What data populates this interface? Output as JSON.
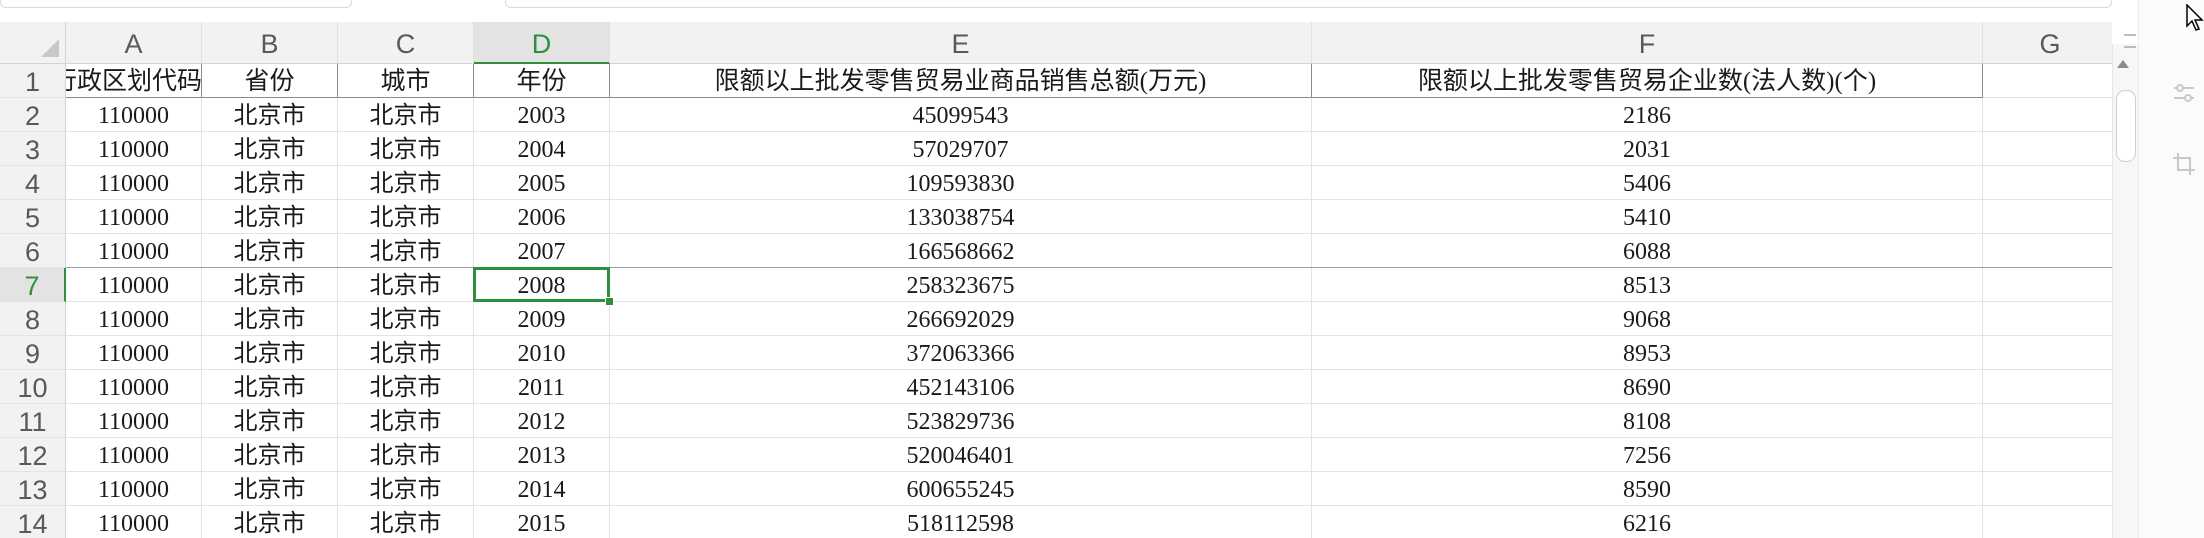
{
  "spreadsheet": {
    "columns": [
      "A",
      "B",
      "C",
      "D",
      "E",
      "F",
      "G"
    ],
    "active_column": "D",
    "active_row": "7",
    "header_row": {
      "number": "1",
      "cells": [
        "行政区划代码",
        "省份",
        "城市",
        "年份",
        "限额以上批发零售贸易业商品销售总额(万元)",
        "限额以上批发零售贸易企业数(法人数)(个)"
      ]
    },
    "rows": [
      {
        "number": "2",
        "cells": [
          "110000",
          "北京市",
          "北京市",
          "2003",
          "45099543",
          "2186"
        ]
      },
      {
        "number": "3",
        "cells": [
          "110000",
          "北京市",
          "北京市",
          "2004",
          "57029707",
          "2031"
        ]
      },
      {
        "number": "4",
        "cells": [
          "110000",
          "北京市",
          "北京市",
          "2005",
          "109593830",
          "5406"
        ]
      },
      {
        "number": "5",
        "cells": [
          "110000",
          "北京市",
          "北京市",
          "2006",
          "133038754",
          "5410"
        ]
      },
      {
        "number": "6",
        "cells": [
          "110000",
          "北京市",
          "北京市",
          "2007",
          "166568662",
          "6088"
        ]
      },
      {
        "number": "7",
        "cells": [
          "110000",
          "北京市",
          "北京市",
          "2008",
          "258323675",
          "8513"
        ]
      },
      {
        "number": "8",
        "cells": [
          "110000",
          "北京市",
          "北京市",
          "2009",
          "266692029",
          "9068"
        ]
      },
      {
        "number": "9",
        "cells": [
          "110000",
          "北京市",
          "北京市",
          "2010",
          "372063366",
          "8953"
        ]
      },
      {
        "number": "10",
        "cells": [
          "110000",
          "北京市",
          "北京市",
          "2011",
          "452143106",
          "8690"
        ]
      },
      {
        "number": "11",
        "cells": [
          "110000",
          "北京市",
          "北京市",
          "2012",
          "523829736",
          "8108"
        ]
      },
      {
        "number": "12",
        "cells": [
          "110000",
          "北京市",
          "北京市",
          "2013",
          "520046401",
          "7256"
        ]
      },
      {
        "number": "13",
        "cells": [
          "110000",
          "北京市",
          "北京市",
          "2014",
          "600655245",
          "8590"
        ]
      },
      {
        "number": "14",
        "cells": [
          "110000",
          "北京市",
          "北京市",
          "2015",
          "518112598",
          "6216"
        ]
      }
    ]
  },
  "colors": {
    "accent": "#2f8f3f",
    "header_bg": "#f2f2f2",
    "gridline": "#e3e3e3"
  },
  "icons": {
    "cursor": "mouse-pointer-icon",
    "side_1": "sliders-icon",
    "side_2": "crop-icon"
  }
}
